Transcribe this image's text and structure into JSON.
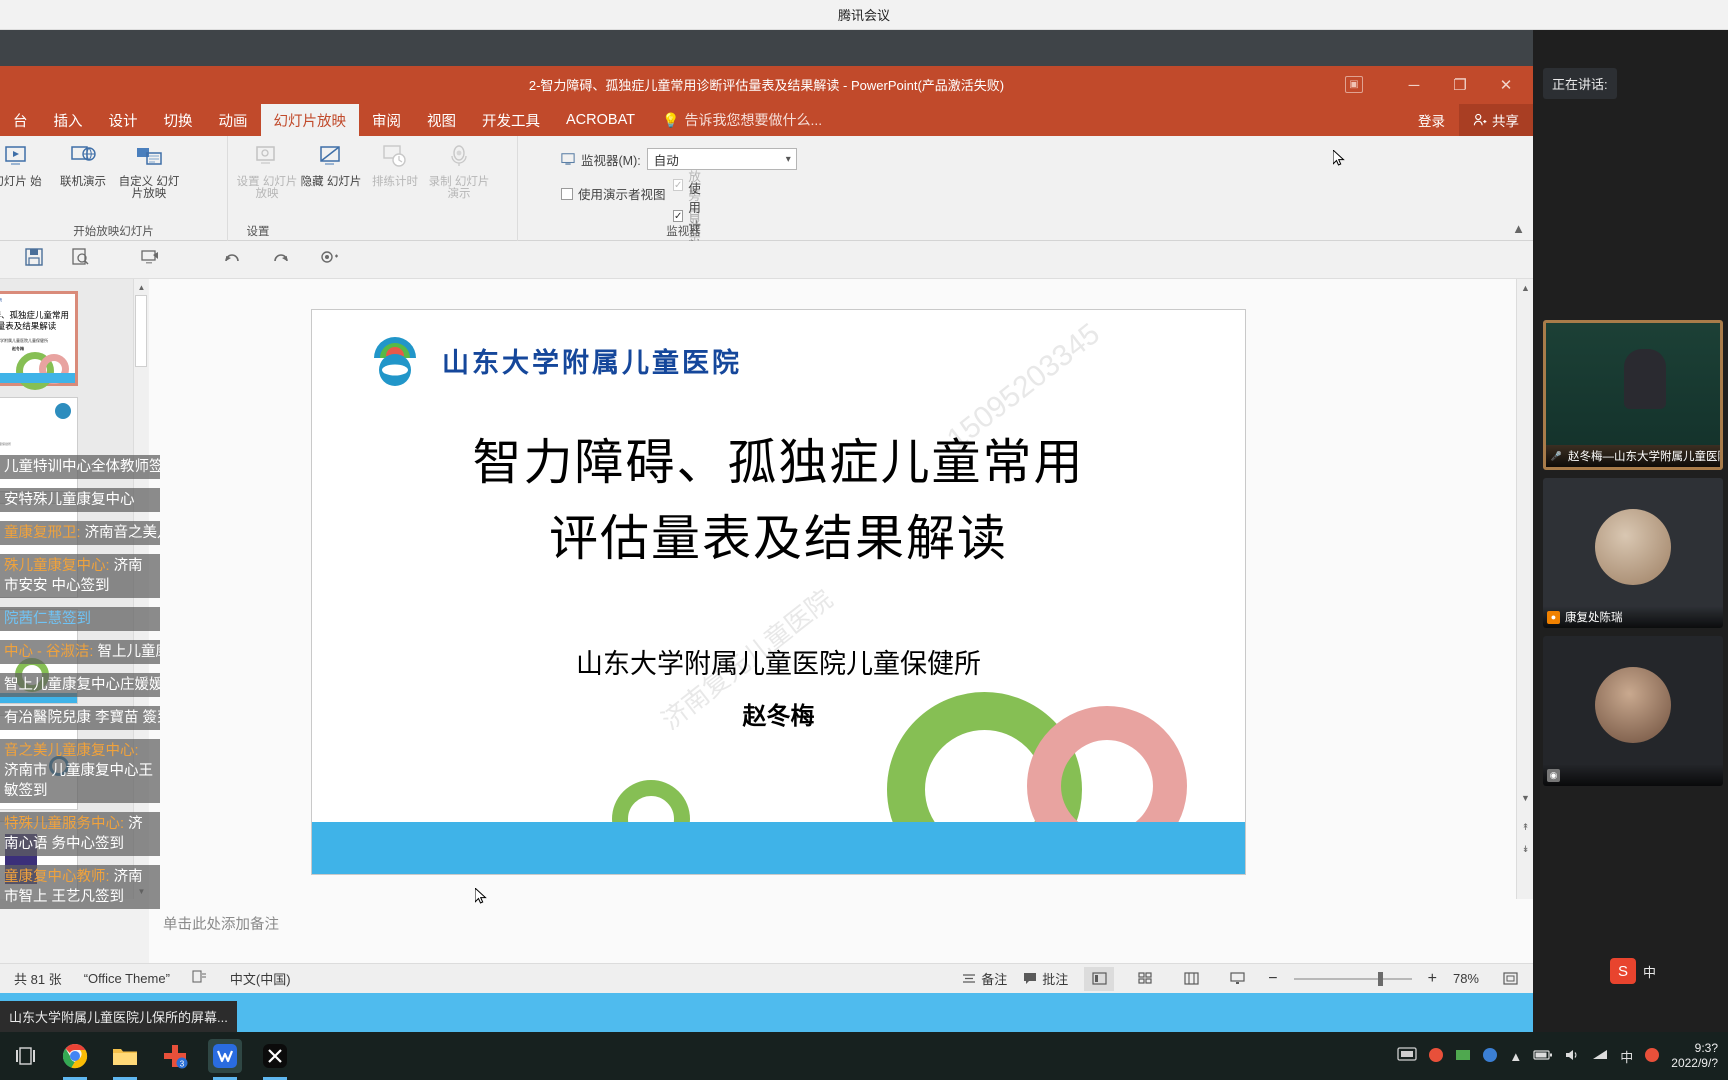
{
  "meeting": {
    "app_title": "腾讯会议",
    "speaking_label": "正在讲话:",
    "participants": [
      {
        "name": "赵冬梅—山东大学附属儿童医院",
        "mic": "mic-on-icon",
        "type": "video"
      },
      {
        "name": "康复处陈瑞",
        "mic": "mic-on-icon",
        "type": "avatar"
      },
      {
        "name": "",
        "mic": "mic-off-icon",
        "type": "avatar"
      }
    ]
  },
  "powerpoint": {
    "title": "2-智力障碍、孤独症儿童常用诊断评估量表及结果解读 - PowerPoint(产品激活失败)",
    "window_buttons": {
      "minimize": "─",
      "restore": "❐",
      "close": "✕"
    },
    "tabs": [
      {
        "label": "台",
        "active": false
      },
      {
        "label": "插入",
        "active": false
      },
      {
        "label": "设计",
        "active": false
      },
      {
        "label": "切换",
        "active": false
      },
      {
        "label": "动画",
        "active": false
      },
      {
        "label": "幻灯片放映",
        "active": true
      },
      {
        "label": "审阅",
        "active": false
      },
      {
        "label": "视图",
        "active": false
      },
      {
        "label": "开发工具",
        "active": false
      },
      {
        "label": "ACROBAT",
        "active": false
      }
    ],
    "tell_me": "告诉我您想要做什么...",
    "sign_in": "登录",
    "share": "共享",
    "ribbon": {
      "groups": [
        {
          "label": "开始放映幻灯片"
        },
        {
          "label": "设置"
        },
        {
          "label": "监视器"
        }
      ],
      "buttons": [
        {
          "label": "幻灯片\n始",
          "icon": "from-beginning-icon",
          "disabled": false
        },
        {
          "label": "联机演示",
          "icon": "present-online-icon",
          "disabled": false
        },
        {
          "label": "自定义\n幻灯片放映",
          "icon": "custom-show-icon",
          "disabled": false
        },
        {
          "label": "设置\n幻灯片放映",
          "icon": "setup-show-icon",
          "disabled": true
        },
        {
          "label": "隐藏\n幻灯片",
          "icon": "hide-slide-icon",
          "disabled": false
        },
        {
          "label": "排练计时",
          "icon": "rehearse-timings-icon",
          "disabled": true
        },
        {
          "label": "录制\n幻灯片演示",
          "icon": "record-slideshow-icon",
          "disabled": true
        }
      ],
      "checkboxes": [
        {
          "label": "播放旁白",
          "checked": true,
          "disabled": true
        },
        {
          "label": "使用计时",
          "checked": true,
          "disabled": false
        },
        {
          "label": "显示媒体控件",
          "checked": true,
          "disabled": true
        }
      ],
      "monitor_label": "监视器(M):",
      "monitor_value": "自动",
      "presenter_view": {
        "label": "使用演示者视图",
        "checked": false
      }
    },
    "quick_access": [
      "save-icon",
      "print-preview-icon",
      "slideshow-icon",
      "undo-icon",
      "redo-icon",
      "touch-mode-icon"
    ],
    "notes_placeholder": "单击此处添加备注",
    "status_bar": {
      "slide_count": "共 81 张",
      "theme": "“Office Theme”",
      "spelling_icon": "spell-check-icon",
      "language": "中文(中国)",
      "notes_button": "备注",
      "comments_button": "批注",
      "views": [
        "normal-view-icon",
        "slide-sorter-icon",
        "reading-view-icon",
        "slideshow-view-icon"
      ],
      "zoom_out": "−",
      "zoom_in": "+",
      "zoom_level": "78%",
      "fit_icon": "fit-to-window-icon"
    }
  },
  "slide": {
    "org_name": "山东大学附属儿童医院",
    "title_line1": "智力障碍、孤独症儿童常用",
    "title_line2": "评估量表及结果解读",
    "subtitle": "山东大学附属儿童医院儿童保健所",
    "presenter": "赵冬梅",
    "watermark1": "济南复元儿童医院",
    "watermark2": "15095203345",
    "colors": {
      "blue_bar": "#3fb3e8",
      "green_ring": "#86bf54",
      "pink_ring": "#e8a3a0",
      "logo_blue": "#15479b"
    }
  },
  "chat_overlay": {
    "messages": [
      {
        "sender": "",
        "text": "儿童特训中心全体教师签到",
        "sender_color": ""
      },
      {
        "sender": "",
        "text": "安特殊儿童康复中心",
        "sender_color": ""
      },
      {
        "sender": "童康复邢卫:",
        "text": "济南音之美儿童",
        "sender_color": "orange"
      },
      {
        "sender": "殊儿童康复中心:",
        "text": "济南市安安 中心签到",
        "sender_color": "orange"
      },
      {
        "sender": "院茜仁慧签到",
        "text": "",
        "sender_color": "blue"
      },
      {
        "sender": "中心 - 谷淑洁:",
        "text": "智上儿童康复",
        "sender_color": "orange"
      },
      {
        "sender": "",
        "text": "智上儿童康复中心庄媛媛签到",
        "sender_color": ""
      },
      {
        "sender": "",
        "text": "有冶醫院兒康 李寶苗 簽到",
        "sender_color": ""
      },
      {
        "sender": "音之美儿童康复中心:",
        "text": "济南市 儿童康复中心王敏签到",
        "sender_color": "orange"
      },
      {
        "sender": "特殊儿童服务中心:",
        "text": "济南心语 务中心签到",
        "sender_color": "orange"
      },
      {
        "sender": "童康复中心教师:",
        "text": "济南市智上 王艺凡签到",
        "sender_color": "orange"
      }
    ]
  },
  "taskbar": {
    "tooltip": "山东大学附属儿童医院儿保所的屏幕...",
    "apps": [
      {
        "name": "task-view-icon",
        "glyph": "❑",
        "active": false
      },
      {
        "name": "chrome-icon",
        "glyph": "◉",
        "active": false
      },
      {
        "name": "file-explorer-icon",
        "glyph": "🗂",
        "active": false
      },
      {
        "name": "health-app-icon",
        "glyph": "✚",
        "active": false
      },
      {
        "name": "tencent-meeting-icon",
        "glyph": "◤",
        "active": true
      },
      {
        "name": "capcut-icon",
        "glyph": "✂",
        "active": false
      }
    ],
    "tray": {
      "ime_label": "中",
      "time": "9:3?",
      "date": "2022/9/?"
    },
    "sogou_ime": {
      "badge": "S",
      "label": "中"
    }
  }
}
